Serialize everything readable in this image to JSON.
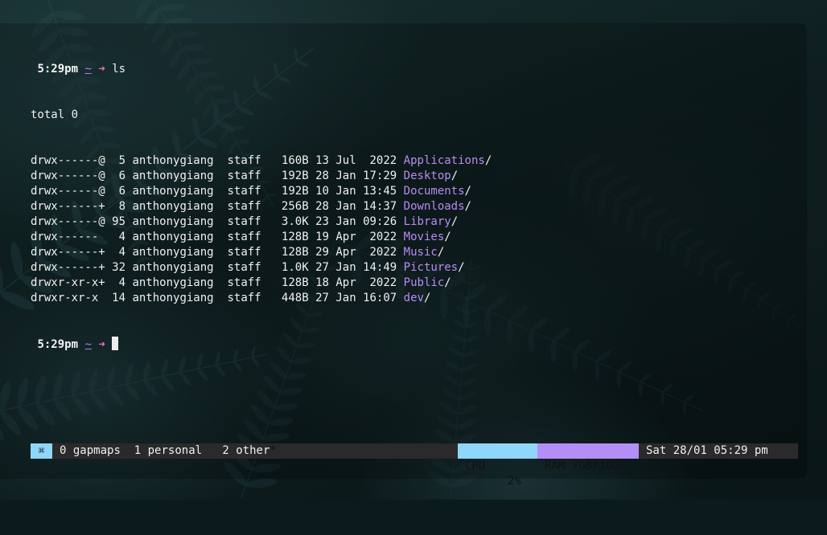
{
  "terminal": {
    "prompt": {
      "time": "5:29pm",
      "cwd": "~",
      "arrow": "➜"
    },
    "command": "ls",
    "total_line": "total 0",
    "entries": [
      {
        "perms": "drwx------@",
        "links": " 5",
        "owner": "anthonygiang",
        "group": "staff",
        "size": " 160B",
        "date": "13 Jul  2022",
        "name": "Applications",
        "suffix": "/"
      },
      {
        "perms": "drwx------@",
        "links": " 6",
        "owner": "anthonygiang",
        "group": "staff",
        "size": " 192B",
        "date": "28 Jan 17:29",
        "name": "Desktop",
        "suffix": "/"
      },
      {
        "perms": "drwx------@",
        "links": " 6",
        "owner": "anthonygiang",
        "group": "staff",
        "size": " 192B",
        "date": "10 Jan 13:45",
        "name": "Documents",
        "suffix": "/"
      },
      {
        "perms": "drwx------+",
        "links": " 8",
        "owner": "anthonygiang",
        "group": "staff",
        "size": " 256B",
        "date": "28 Jan 14:37",
        "name": "Downloads",
        "suffix": "/"
      },
      {
        "perms": "drwx------@",
        "links": "95",
        "owner": "anthonygiang",
        "group": "staff",
        "size": " 3.0K",
        "date": "23 Jan 09:26",
        "name": "Library",
        "suffix": "/"
      },
      {
        "perms": "drwx------ ",
        "links": " 4",
        "owner": "anthonygiang",
        "group": "staff",
        "size": " 128B",
        "date": "19 Apr  2022",
        "name": "Movies",
        "suffix": "/"
      },
      {
        "perms": "drwx------+",
        "links": " 4",
        "owner": "anthonygiang",
        "group": "staff",
        "size": " 128B",
        "date": "29 Apr  2022",
        "name": "Music",
        "suffix": "/"
      },
      {
        "perms": "drwx------+",
        "links": "32",
        "owner": "anthonygiang",
        "group": "staff",
        "size": " 1.0K",
        "date": "27 Jan 14:49",
        "name": "Pictures",
        "suffix": "/"
      },
      {
        "perms": "drwxr-xr-x+",
        "links": " 4",
        "owner": "anthonygiang",
        "group": "staff",
        "size": " 128B",
        "date": "18 Apr  2022",
        "name": "Public",
        "suffix": "/"
      },
      {
        "perms": "drwxr-xr-x ",
        "links": "14",
        "owner": "anthonygiang",
        "group": "staff",
        "size": " 448B",
        "date": "27 Jan 16:07",
        "name": "dev",
        "suffix": "/"
      }
    ]
  },
  "statusbar": {
    "session_icon": "⌘",
    "windows": [
      {
        "index": "0",
        "name": "gapmaps"
      },
      {
        "index": "1",
        "name": "personal"
      },
      {
        "index": "2",
        "name": "other",
        "flag": "*"
      }
    ],
    "cpu_label": "CPU",
    "cpu_value": "2%",
    "ram_label": "RAM 7GB/16GB",
    "datetime": "Sat 28/01 05:29 pm"
  },
  "colors": {
    "directory": "#b98bf2",
    "prompt_arrow": "#f06ec0",
    "prompt_cwd": "#b07ef5",
    "status_cyan": "#8fd6fb",
    "status_purple": "#b48ef7",
    "status_bg": "#2a2a2a"
  }
}
